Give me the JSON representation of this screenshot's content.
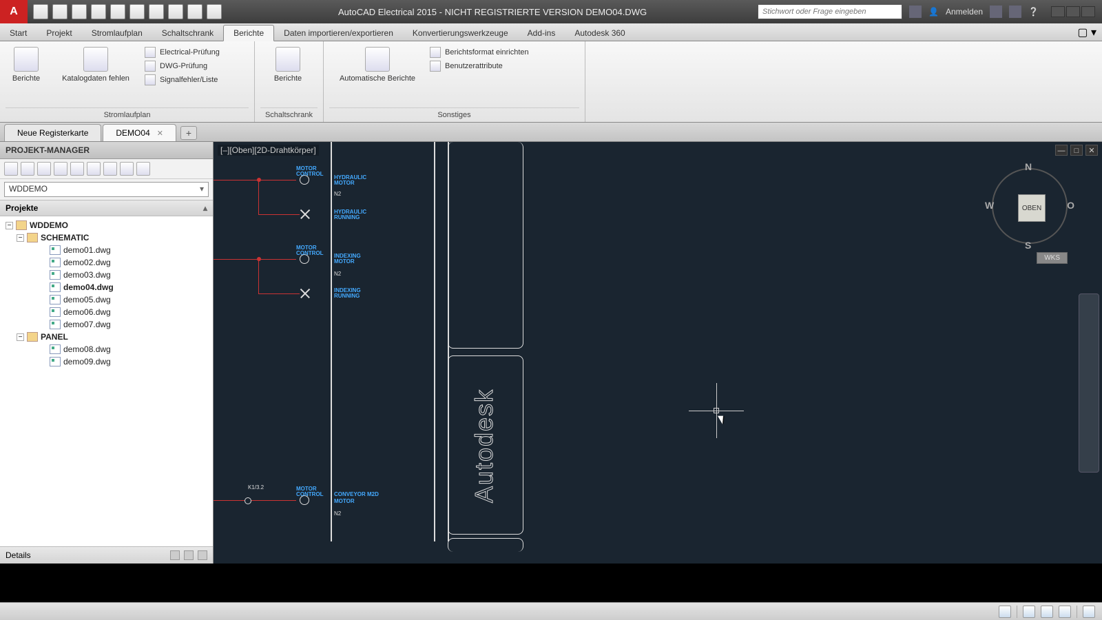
{
  "title": "AutoCAD Electrical 2015 - NICHT REGISTRIERTE VERSION   DEMO04.DWG",
  "search_placeholder": "Stichwort oder Frage eingeben",
  "signin": "Anmelden",
  "tabs": {
    "start": "Start",
    "projekt": "Projekt",
    "stromlaufplan": "Stromlaufplan",
    "schaltschrank": "Schaltschrank",
    "berichte": "Berichte",
    "daten": "Daten importieren/exportieren",
    "konvert": "Konvertierungswerkzeuge",
    "addins": "Add-ins",
    "a360": "Autodesk 360"
  },
  "ribbon": {
    "p1": {
      "btn1": "Berichte",
      "btn2": "Katalogdaten fehlen",
      "s1": "Electrical-Prüfung",
      "s2": "DWG-Prüfung",
      "s3": "Signalfehler/Liste",
      "title": "Stromlaufplan"
    },
    "p2": {
      "btn1": "Berichte",
      "title": "Schaltschrank"
    },
    "p3": {
      "btn1": "Automatische Berichte",
      "s1": "Berichtsformat einrichten",
      "s2": "Benutzerattribute",
      "title": "Sonstiges"
    }
  },
  "doctabs": {
    "new": "Neue Registerkarte",
    "active": "DEMO04"
  },
  "pm": {
    "title": "PROJEKT-MANAGER",
    "combo": "WDDEMO",
    "section": "Projekte",
    "details": "Details",
    "tree": {
      "root": "WDDEMO",
      "f1": "SCHEMATIC",
      "d1": "demo01.dwg",
      "d2": "demo02.dwg",
      "d3": "demo03.dwg",
      "d4": "demo04.dwg",
      "d5": "demo05.dwg",
      "d6": "demo06.dwg",
      "d7": "demo07.dwg",
      "f2": "PANEL",
      "d8": "demo08.dwg",
      "d9": "demo09.dwg"
    }
  },
  "canvas": {
    "viewlabel": "[–][Oben][2D-Drahtkörper]",
    "cube": {
      "face": "OBEN",
      "n": "N",
      "s": "S",
      "w": "W",
      "o": "O"
    },
    "wks": "WKS",
    "adsk": "Autodesk",
    "annot": {
      "m1a": "MOTOR",
      "m1b": "CONTROL",
      "hyd1": "HYDRAULIC",
      "hyd2": "MOTOR",
      "r1": "RUNNING",
      "ind1": "INDEXING",
      "ind2": "MOTOR",
      "n1": "N2",
      "n2": "N2",
      "n3": "N2",
      "conv": "CONVEYOR   M2D",
      "k1": "K1/3.2"
    }
  }
}
